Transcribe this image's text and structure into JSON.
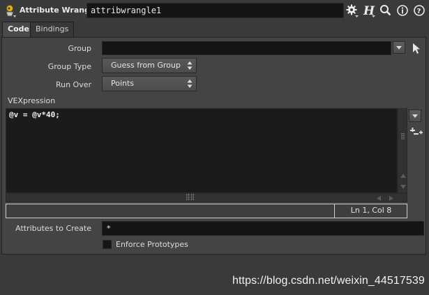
{
  "header": {
    "node_type": "Attribute Wrangle",
    "node_name": "attribwrangle1",
    "icons": [
      "node-type-icon",
      "gear-icon",
      "houdini-h-icon",
      "search-icon",
      "info-icon",
      "help-icon"
    ]
  },
  "tabs": [
    {
      "label": "Code",
      "active": true
    },
    {
      "label": "Bindings",
      "active": false
    }
  ],
  "params": {
    "group": {
      "label": "Group",
      "value": ""
    },
    "group_type": {
      "label": "Group Type",
      "value": "Guess from Group"
    },
    "run_over": {
      "label": "Run Over",
      "value": "Points"
    },
    "vexpression": {
      "label": "VEXpression",
      "code": "@v = @v*40;",
      "cursor_status": "Ln 1, Col 8"
    },
    "attributes_to_create": {
      "label": "Attributes to Create",
      "value": "*"
    },
    "enforce_prototypes": {
      "label": "Enforce Prototypes",
      "checked": false
    }
  },
  "watermark": "https://blog.csdn.net/weixin_44517539",
  "colors": {
    "background": "#3a3a3a",
    "panel": "#444444",
    "field": "#141414",
    "node_icon_yellow": "#e6b422"
  }
}
